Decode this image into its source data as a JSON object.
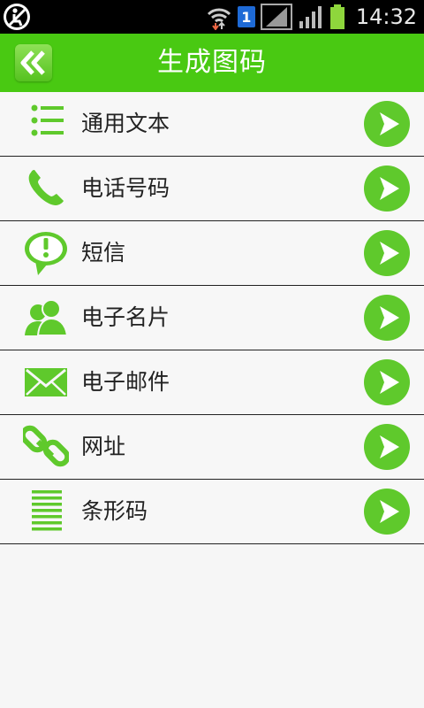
{
  "status_bar": {
    "time": "14:32",
    "sim_label": "1"
  },
  "header": {
    "title": "生成图码"
  },
  "list": [
    {
      "label": "通用文本",
      "icon": "list-icon"
    },
    {
      "label": "电话号码",
      "icon": "phone-icon"
    },
    {
      "label": "短信",
      "icon": "sms-icon"
    },
    {
      "label": "电子名片",
      "icon": "contacts-icon"
    },
    {
      "label": "电子邮件",
      "icon": "mail-icon"
    },
    {
      "label": "网址",
      "icon": "link-icon"
    },
    {
      "label": "条形码",
      "icon": "barcode-icon"
    }
  ],
  "colors": {
    "accent": "#49c912",
    "icon_green": "#5fc92c"
  }
}
